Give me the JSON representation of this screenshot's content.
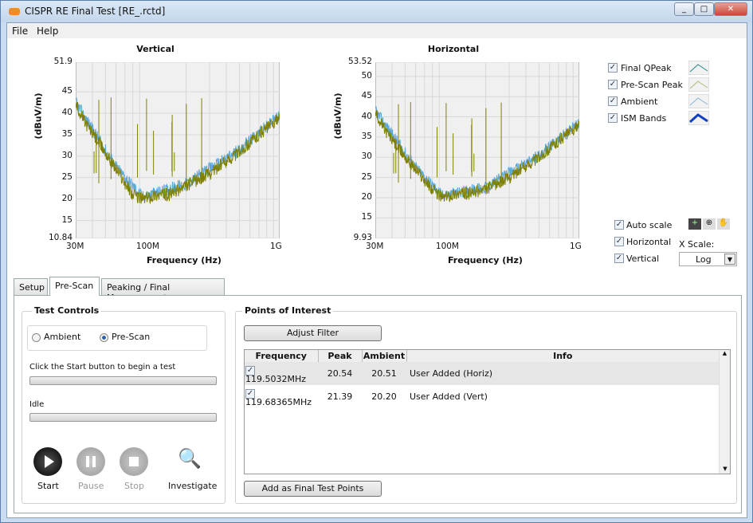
{
  "window": {
    "title": "CISPR RE Final Test [RE_.rctd]",
    "controls": [
      "minimize",
      "maximize",
      "close"
    ]
  },
  "menu": [
    "File",
    "Help"
  ],
  "charts": {
    "vertical": {
      "title": "Vertical",
      "ylabel": "(dBuV/m)",
      "xlabel": "Frequency (Hz)",
      "yticks": [
        "51.9",
        "45",
        "40",
        "35",
        "30",
        "25",
        "20",
        "15",
        "10.84"
      ],
      "xticks": [
        "30M",
        "100M",
        "1G"
      ]
    },
    "horizontal": {
      "title": "Horizontal",
      "ylabel": "(dBuV/m)",
      "xlabel": "Frequency (Hz)",
      "yticks": [
        "53.52",
        "50",
        "45",
        "40",
        "35",
        "30",
        "25",
        "20",
        "15",
        "9.93"
      ],
      "xticks": [
        "30M",
        "100M",
        "1G"
      ]
    }
  },
  "chart_data": [
    {
      "type": "line",
      "title": "Vertical",
      "xlabel": "Frequency (Hz)",
      "ylabel": "(dBuV/m)",
      "x_scale": "log",
      "xlim": [
        30000000,
        1000000000
      ],
      "ylim": [
        10.84,
        51.9
      ],
      "grid": true,
      "series": [
        {
          "color": "#808000",
          "x": [
            30000000.0,
            35000000.0,
            45000000.0,
            60000000.0,
            80000000.0,
            95000000.0,
            120000000.0,
            150000000.0,
            200000000.0,
            300000000.0,
            500000000.0,
            700000000.0,
            1000000000.0
          ],
          "y": [
            42,
            38,
            33,
            27,
            21,
            20,
            21,
            21,
            23,
            26,
            31,
            35,
            39
          ]
        },
        {
          "color": "#5aa7d8",
          "x": [
            30000000.0,
            60000000.0,
            95000000.0,
            200000000.0,
            500000000.0,
            1000000000.0
          ],
          "y": [
            42.5,
            27.5,
            20.5,
            23.5,
            31.5,
            39.5
          ]
        }
      ]
    },
    {
      "type": "line",
      "title": "Horizontal",
      "xlabel": "Frequency (Hz)",
      "ylabel": "(dBuV/m)",
      "x_scale": "log",
      "xlim": [
        30000000,
        1000000000
      ],
      "ylim": [
        9.93,
        53.52
      ],
      "grid": true,
      "series": [
        {
          "color": "#808000",
          "x": [
            30000000.0,
            35000000.0,
            45000000.0,
            60000000.0,
            80000000.0,
            95000000.0,
            120000000.0,
            150000000.0,
            200000000.0,
            300000000.0,
            500000000.0,
            700000000.0,
            1000000000.0
          ],
          "y": [
            41,
            37,
            32,
            27,
            22,
            20,
            21,
            21,
            22,
            25,
            30,
            34,
            38
          ]
        },
        {
          "color": "#5aa7d8",
          "x": [
            30000000.0,
            60000000.0,
            95000000.0,
            200000000.0,
            500000000.0,
            1000000000.0
          ],
          "y": [
            41.5,
            27.5,
            20.5,
            22.5,
            30.5,
            38.5
          ]
        }
      ]
    }
  ],
  "legend": [
    {
      "label": "Final QPeak",
      "checked": true,
      "color": "#1a8a8a"
    },
    {
      "label": "Pre-Scan Peak",
      "checked": true,
      "color": "#b5b57a"
    },
    {
      "label": "Ambient",
      "checked": true,
      "color": "#8ab4d8"
    },
    {
      "label": "ISM Bands",
      "checked": true,
      "color": "#1040c0"
    }
  ],
  "scale": {
    "auto_scale": "Auto scale",
    "horizontal": "Horizontal",
    "vertical": "Vertical",
    "x_scale_label": "X Scale:",
    "x_scale_value": "Log"
  },
  "tabs": [
    "Setup",
    "Pre-Scan",
    "Peaking / Final Measurement"
  ],
  "test_controls": {
    "title": "Test Controls",
    "radio": [
      "Ambient",
      "Pre-Scan"
    ],
    "selected": "Pre-Scan",
    "instruction": "Click the Start button to begin a test",
    "progress1": 0,
    "status": "Idle",
    "progress2": 0,
    "buttons": {
      "start": "Start",
      "pause": "Pause",
      "stop": "Stop",
      "investigate": "Investigate"
    }
  },
  "poi": {
    "title": "Points of Interest",
    "adjust_filter": "Adjust Filter",
    "add_final": "Add as Final Test Points",
    "columns": [
      "Frequency",
      "Peak",
      "Ambient",
      "Info"
    ],
    "rows": [
      {
        "checked": true,
        "frequency": "119.5032MHz",
        "peak": "20.54",
        "ambient": "20.51",
        "info": "User Added (Horiz)"
      },
      {
        "checked": true,
        "frequency": "119.68365MHz",
        "peak": "21.39",
        "ambient": "20.20",
        "info": "User Added (Vert)"
      }
    ]
  }
}
